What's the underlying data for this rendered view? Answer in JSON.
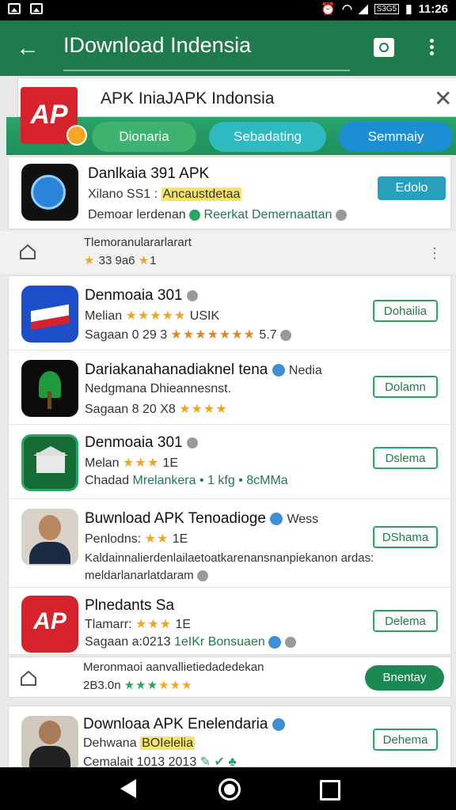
{
  "status_bar": {
    "time": "11:26",
    "network": "S3G5"
  },
  "app_bar": {
    "title": "IDownload Indensia"
  },
  "search": {
    "text": "APK IniaJAPK Indonsia"
  },
  "chips": [
    "Dionaria",
    "Sebadating",
    "Semmaiy"
  ],
  "cards": [
    {
      "name": "Danlkaia 391 APK",
      "sub_prefix": "Xilano SS1 :",
      "sub_highlight": "Ancaustdetaa",
      "meta": "Demoar lerdenan",
      "meta2": "Reerkat Demernaattan",
      "button": "Edolo"
    },
    {
      "name": "Denmoaia 301",
      "sub": "Melian",
      "sub2": "USIK",
      "meta": "Sagaan 0 29 3",
      "rating": "5.7",
      "button": "Dohailia"
    },
    {
      "name": "Dariakanahanadiaknel tena",
      "tag": "Nedia",
      "sub": "Nedgmana Dhieannesnst.",
      "meta": "Sagaan 8 20 X8",
      "button": "Dolamn"
    },
    {
      "name": "Denmoaia 301",
      "sub": "Melan",
      "sub2": "1E",
      "meta": "Chadad",
      "meta2": "Mrelankera",
      "meta3": "1 kfg",
      "meta4": "8cMMa",
      "button": "Dslema"
    },
    {
      "name": "Buwnload APK Tenoadioge",
      "tag": "Wess",
      "sub": "Penlodns:",
      "sub2": "1E",
      "desc": "Kaldainnalierdenlailaetoatkarenansnanpiekanon ardas:",
      "desc2": "meldarlanarlatdaram",
      "button": "DShama"
    },
    {
      "name": "Plnedants Sa",
      "sub": "Tlamarr:",
      "sub2": "1E",
      "meta": "Sagaan a:0213",
      "meta2": "1eIKr Bonsuaen",
      "button": "Delema"
    },
    {
      "name": "Downloaa APK Enelendaria",
      "sub": "Dehwana",
      "sub_highlight": "BOIelelia",
      "meta": "Cemalait 1013 2013",
      "button": "Dehema"
    }
  ],
  "promo_rows": [
    {
      "title": "Tlemoranulararlarart",
      "sub": "33 9a6",
      "sub2": "1"
    },
    {
      "title": "Meronmaoi aanvallietiedadedekan",
      "sub": "2B3.0n",
      "button": "Bnentay"
    }
  ],
  "colors": {
    "appbar": "#1f7a4c",
    "accent": "#2aa664",
    "teal": "#27a0bd",
    "blue": "#1c8ed3",
    "red": "#d6232b"
  }
}
